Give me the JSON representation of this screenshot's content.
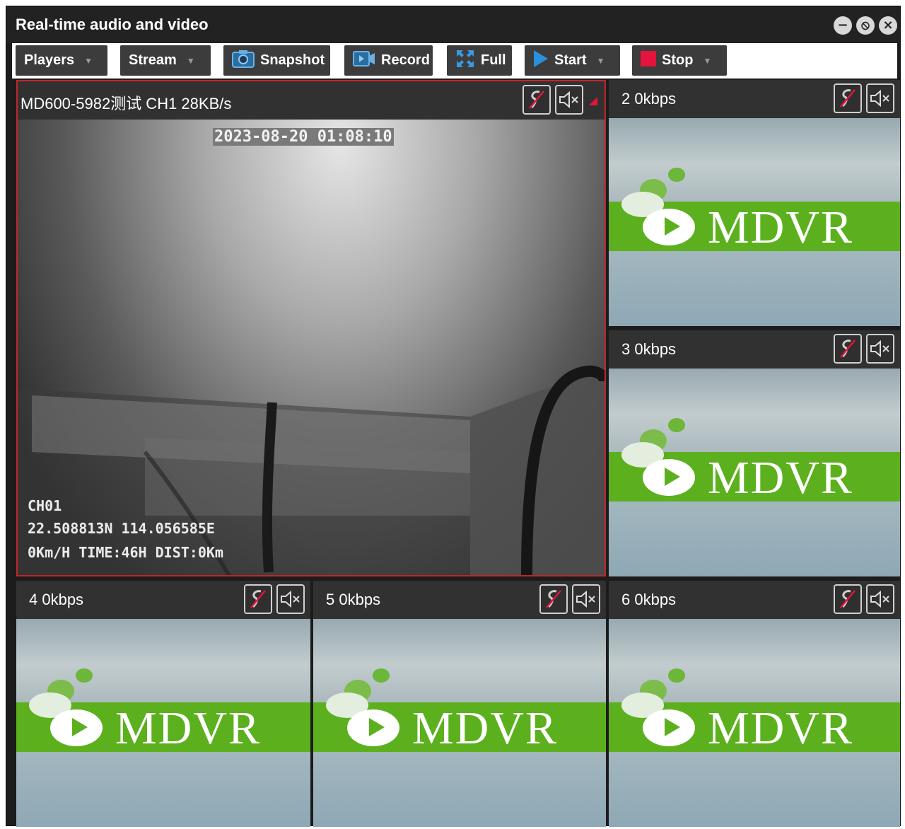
{
  "window": {
    "title": "Real-time audio and video",
    "controls": [
      "minus-icon",
      "block-icon",
      "close-icon"
    ]
  },
  "toolbar": {
    "players_label": "Players",
    "stream_label": "Stream",
    "snapshot_label": "Snapshot",
    "record_label": "Record",
    "full_label": "Full",
    "start_label": "Start",
    "stop_label": "Stop"
  },
  "channels": {
    "ch1": {
      "title": "MD600-5982测试  CH1   28KB/s",
      "timestamp": "2023-08-20 01:08:10",
      "overlay_channel": "CH01",
      "overlay_coords": "22.508813N 114.056585E",
      "overlay_stats": "0Km/H TIME:46H DIST:0Km"
    },
    "ch2": {
      "title": "2  0kbps",
      "logo": "MDVR"
    },
    "ch3": {
      "title": "3  0kbps",
      "logo": "MDVR"
    },
    "ch4": {
      "title": "4  0kbps",
      "logo": "MDVR"
    },
    "ch5": {
      "title": "5  0kbps",
      "logo": "MDVR"
    },
    "ch6": {
      "title": "6  0kbps",
      "logo": "MDVR"
    }
  },
  "colors": {
    "accent_green": "#5cb01e",
    "start_blue": "#2b8fdc",
    "stop_red": "#e5143c",
    "active_border": "#c0262c"
  },
  "icons": {
    "talk": "talk-muted-icon",
    "audio": "speaker-muted-icon"
  }
}
